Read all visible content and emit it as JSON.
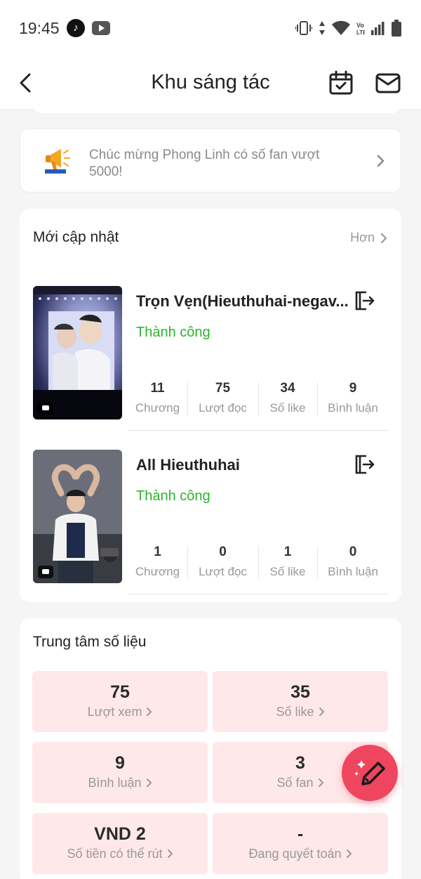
{
  "status_bar": {
    "time": "19:45",
    "network": "Vo LTE"
  },
  "header": {
    "title": "Khu sáng tác"
  },
  "notice": {
    "text": "Chúc mừng Phong Linh có số fan vượt 5000!"
  },
  "updates": {
    "title": "Mới cập nhật",
    "more": "Hơn",
    "works": [
      {
        "title": "Trọn Vẹn(Hieuthuhai-negav...",
        "status": "Thành công",
        "stats": [
          {
            "value": "11",
            "label": "Chương"
          },
          {
            "value": "75",
            "label": "Lượt đọc"
          },
          {
            "value": "34",
            "label": "Số like"
          },
          {
            "value": "9",
            "label": "Bình luận"
          }
        ]
      },
      {
        "title": "All Hieuthuhai",
        "status": "Thành công",
        "stats": [
          {
            "value": "1",
            "label": "Chương"
          },
          {
            "value": "0",
            "label": "Lượt đọc"
          },
          {
            "value": "1",
            "label": "Số like"
          },
          {
            "value": "0",
            "label": "Bình luận"
          }
        ]
      }
    ]
  },
  "data_center": {
    "title": "Trung tâm số liệu",
    "tiles": [
      {
        "value": "75",
        "label": "Lượt xem"
      },
      {
        "value": "35",
        "label": "Số like"
      },
      {
        "value": "9",
        "label": "Bình luận"
      },
      {
        "value": "3",
        "label": "Số fan"
      },
      {
        "value": "VND 2",
        "label": "Số tiền có thể rút"
      },
      {
        "value": "-",
        "label": "Đang quyết toán"
      }
    ]
  },
  "colors": {
    "accent": "#f0455f",
    "success": "#2db52d",
    "tile_bg": "#ffe8ea"
  },
  "icons": [
    "tiktok-icon",
    "youtube-icon",
    "vibrate-icon",
    "data-icon",
    "wifi-icon",
    "signal-icon",
    "battery-icon",
    "back-arrow-icon",
    "calendar-check-icon",
    "mail-icon",
    "megaphone-icon",
    "chevron-right-icon",
    "export-icon",
    "comment-icon",
    "pen-sparkle-icon"
  ]
}
